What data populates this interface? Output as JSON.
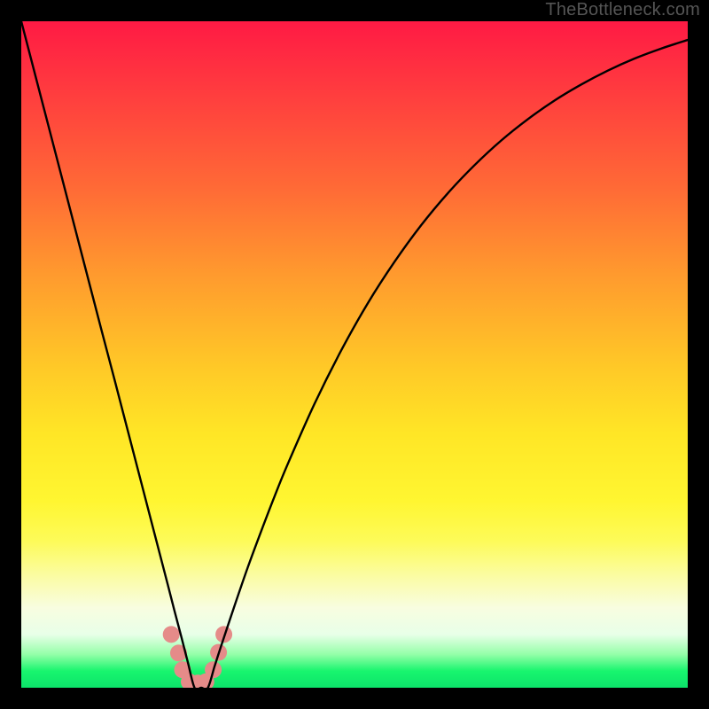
{
  "watermark": {
    "text": "TheBottleneck.com"
  },
  "chart_data": {
    "type": "line",
    "title": "",
    "xlabel": "",
    "ylabel": "",
    "xlim": [
      0,
      100
    ],
    "ylim": [
      0,
      100
    ],
    "x": [
      0,
      2,
      4,
      6,
      8,
      10,
      12,
      14,
      16,
      18,
      20,
      22,
      23,
      24,
      25,
      26,
      27,
      28,
      29,
      30,
      32,
      34,
      36,
      38,
      40,
      44,
      48,
      52,
      56,
      60,
      64,
      68,
      72,
      76,
      80,
      84,
      88,
      92,
      96,
      100
    ],
    "values": [
      100,
      92.3,
      84.6,
      76.9,
      69.2,
      61.5,
      53.8,
      46.2,
      38.5,
      30.8,
      23.1,
      15.4,
      11.5,
      7.7,
      3.8,
      0,
      0,
      0,
      3.2,
      6.3,
      12.3,
      18.1,
      23.5,
      28.7,
      33.6,
      42.6,
      50.6,
      57.7,
      63.9,
      69.4,
      74.2,
      78.4,
      82.1,
      85.3,
      88.1,
      90.5,
      92.6,
      94.4,
      95.9,
      97.2
    ],
    "grid": false,
    "legend": false,
    "markers": {
      "series": "bottleneck-bumps",
      "color": "#e58b89",
      "points": [
        {
          "x": 22.5,
          "y": 8.0
        },
        {
          "x": 23.6,
          "y": 5.2
        },
        {
          "x": 24.2,
          "y": 2.7
        },
        {
          "x": 25.2,
          "y": 0.9
        },
        {
          "x": 26.5,
          "y": 0.7
        },
        {
          "x": 27.7,
          "y": 0.9
        },
        {
          "x": 28.8,
          "y": 2.7
        },
        {
          "x": 29.6,
          "y": 5.3
        },
        {
          "x": 30.4,
          "y": 8.0
        }
      ]
    }
  }
}
